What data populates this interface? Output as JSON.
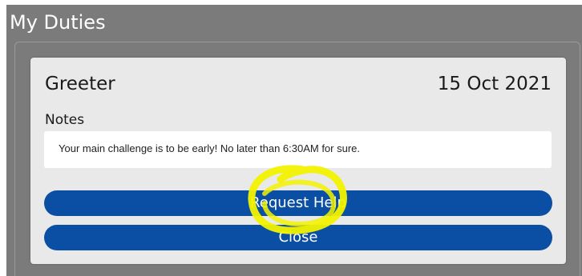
{
  "header": {
    "title": "My Duties"
  },
  "duty": {
    "name": "Greeter",
    "date": "15 Oct 2021",
    "notes_label": "Notes",
    "notes_text": "Your main challenge is to be early! No later than 6:30AM for sure."
  },
  "actions": {
    "request_help_label": "Request Help",
    "close_label": "Close"
  },
  "colors": {
    "header_bg": "#7b7b7b",
    "card_bg": "#e9e9e9",
    "button_bg": "#0a4fa3",
    "highlight": "#f2f200"
  }
}
